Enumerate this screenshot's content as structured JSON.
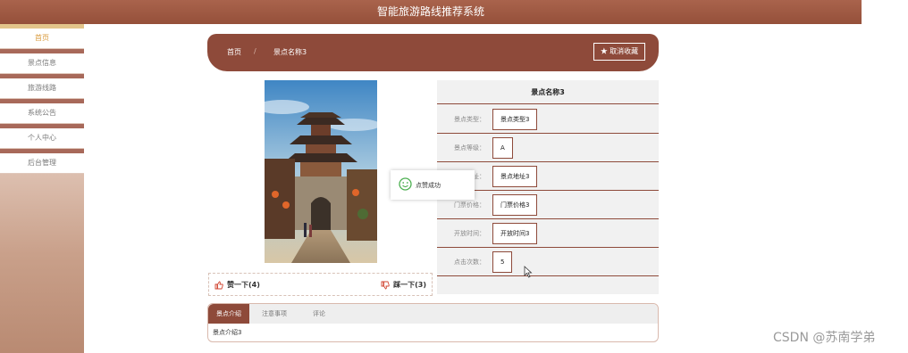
{
  "app": {
    "title": "智能旅游路线推荐系统"
  },
  "sidebar": {
    "items": [
      {
        "label": "首页",
        "active": true
      },
      {
        "label": "景点信息"
      },
      {
        "label": "旅游线路"
      },
      {
        "label": "系统公告"
      },
      {
        "label": "个人中心"
      },
      {
        "label": "后台管理"
      }
    ]
  },
  "breadcrumb": {
    "home": "首页",
    "separator": "/",
    "current": "景点名称3"
  },
  "actions": {
    "unfavorite_label": "取消收藏",
    "unfavorite_icon": "star-icon"
  },
  "vote": {
    "like_label": "赞一下(4)",
    "dislike_label": "踩一下(3)"
  },
  "detail": {
    "title": "景点名称3",
    "fields": [
      {
        "label": "景点类型：",
        "value": "景点类型3"
      },
      {
        "label": "景点等级：",
        "value": "A"
      },
      {
        "label": "景点地址：",
        "value": "景点地址3"
      },
      {
        "label": "门票价格：",
        "value": "门票价格3"
      },
      {
        "label": "开放时间：",
        "value": "开放时间3"
      },
      {
        "label": "点击次数：",
        "value": "5"
      }
    ]
  },
  "toast": {
    "message": "点赞成功"
  },
  "tabs": {
    "items": [
      "景点介绍",
      "注意事项",
      "评论"
    ],
    "active": 0,
    "content": "景点介绍3"
  },
  "watermark": "CSDN @苏南学弟",
  "colors": {
    "primary": "#8e4a3a",
    "topbar": "#a9634c",
    "active_nav": "#d99a3b"
  }
}
